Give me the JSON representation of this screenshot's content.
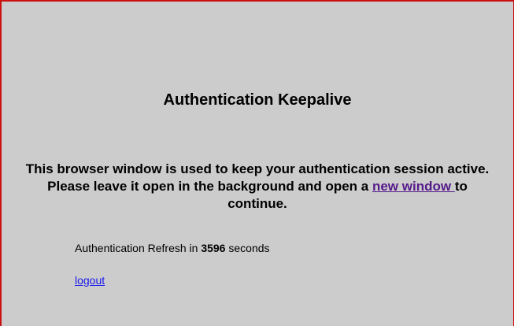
{
  "page": {
    "title": "Authentication Keepalive",
    "message_before_link": "This browser window is used to keep your authentication session active. Please leave it open in the background and open a ",
    "new_window_link": "new window ",
    "message_after_link": "to continue.",
    "refresh_prefix": "Authentication Refresh in ",
    "refresh_seconds": "3596",
    "refresh_suffix": " seconds",
    "logout_link": "logout"
  },
  "colors": {
    "background": "#cccccc",
    "border": "#cc1111",
    "visited_link": "#551a8b",
    "link": "#1a1aee"
  }
}
